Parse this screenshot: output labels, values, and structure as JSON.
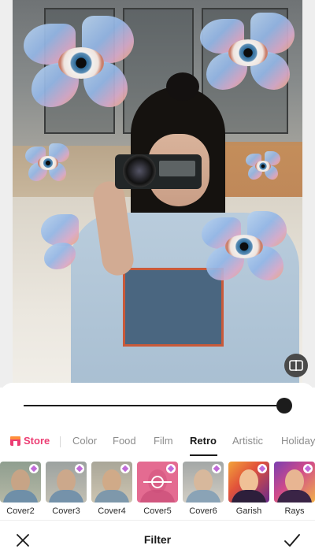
{
  "editor": {
    "screen_title": "Filter",
    "intensity_percent": 100
  },
  "tabs": {
    "store_label": "Store",
    "items": [
      {
        "label": "Color"
      },
      {
        "label": "Food"
      },
      {
        "label": "Film"
      },
      {
        "label": "Retro",
        "active": true
      },
      {
        "label": "Artistic"
      },
      {
        "label": "Holiday"
      }
    ]
  },
  "filters": [
    {
      "label": "Cover2",
      "premium": true
    },
    {
      "label": "Cover3",
      "premium": true
    },
    {
      "label": "Cover4",
      "premium": true
    },
    {
      "label": "Cover5",
      "premium": true,
      "selected": true
    },
    {
      "label": "Cover6",
      "premium": true
    },
    {
      "label": "Garish",
      "premium": true
    },
    {
      "label": "Rays",
      "premium": true
    }
  ],
  "colors": {
    "accent_store": "#ec3d73",
    "selected_filter": "#e46b91",
    "active_tab": "#1a1a1a",
    "inactive_tab": "#8c8c8c"
  },
  "icons": {
    "compare": "compare-icon",
    "store": "store-icon",
    "premium": "diamond-icon",
    "close": "close-icon",
    "confirm": "checkmark-icon"
  }
}
